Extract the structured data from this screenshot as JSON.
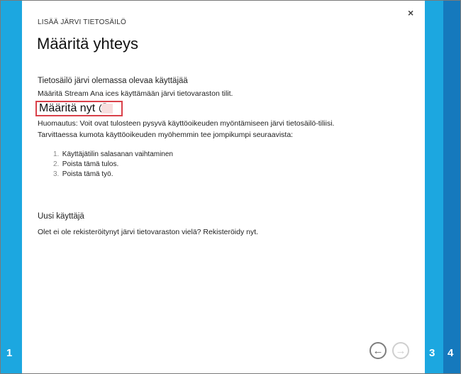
{
  "wizard": {
    "supertitle": "LISÄÄ JÄRVI TIETOSÄILÖ",
    "title": "Määritä yhteys",
    "close_glyph": "×",
    "steps": {
      "left": "1",
      "right_a": "3",
      "right_b": "4"
    }
  },
  "existing_user": {
    "heading": "Tietosäilö järvi olemassa olevaa käyttäjää",
    "description": "Määritä Stream Ana ices käyttämään järvi tietovaraston tilit.",
    "define_now_label": "Määritä nyt @",
    "note": "Huomautus: Voit ovat tulosteen pysyvä käyttöoikeuden myöntämiseen järvi tietosäilö-tiliisi.",
    "revoke_intro": "Tarvittaessa kumota käyttöoikeuden myöhemmin tee jompikumpi seuraavista:",
    "revoke_steps": [
      {
        "num": "1.",
        "text": "Käyttäjätilin salasanan vaihtaminen"
      },
      {
        "num": "2.",
        "text": "Poista tämä tulos."
      },
      {
        "num": "3.",
        "text": "Poista tämä työ."
      }
    ]
  },
  "new_user": {
    "heading": "Uusi käyttäjä",
    "description": "Olet ei ole rekisteröitynyt järvi tietovaraston vielä? Rekisteröidy nyt."
  },
  "nav": {
    "back_glyph": "←",
    "next_glyph": "→"
  },
  "colors": {
    "rail_light": "#1ca7e0",
    "rail_dark": "#1579bd",
    "highlight_border": "#d9414a"
  },
  "icons": {
    "close": "close-icon",
    "back": "arrow-left-icon",
    "next": "arrow-right-icon"
  }
}
